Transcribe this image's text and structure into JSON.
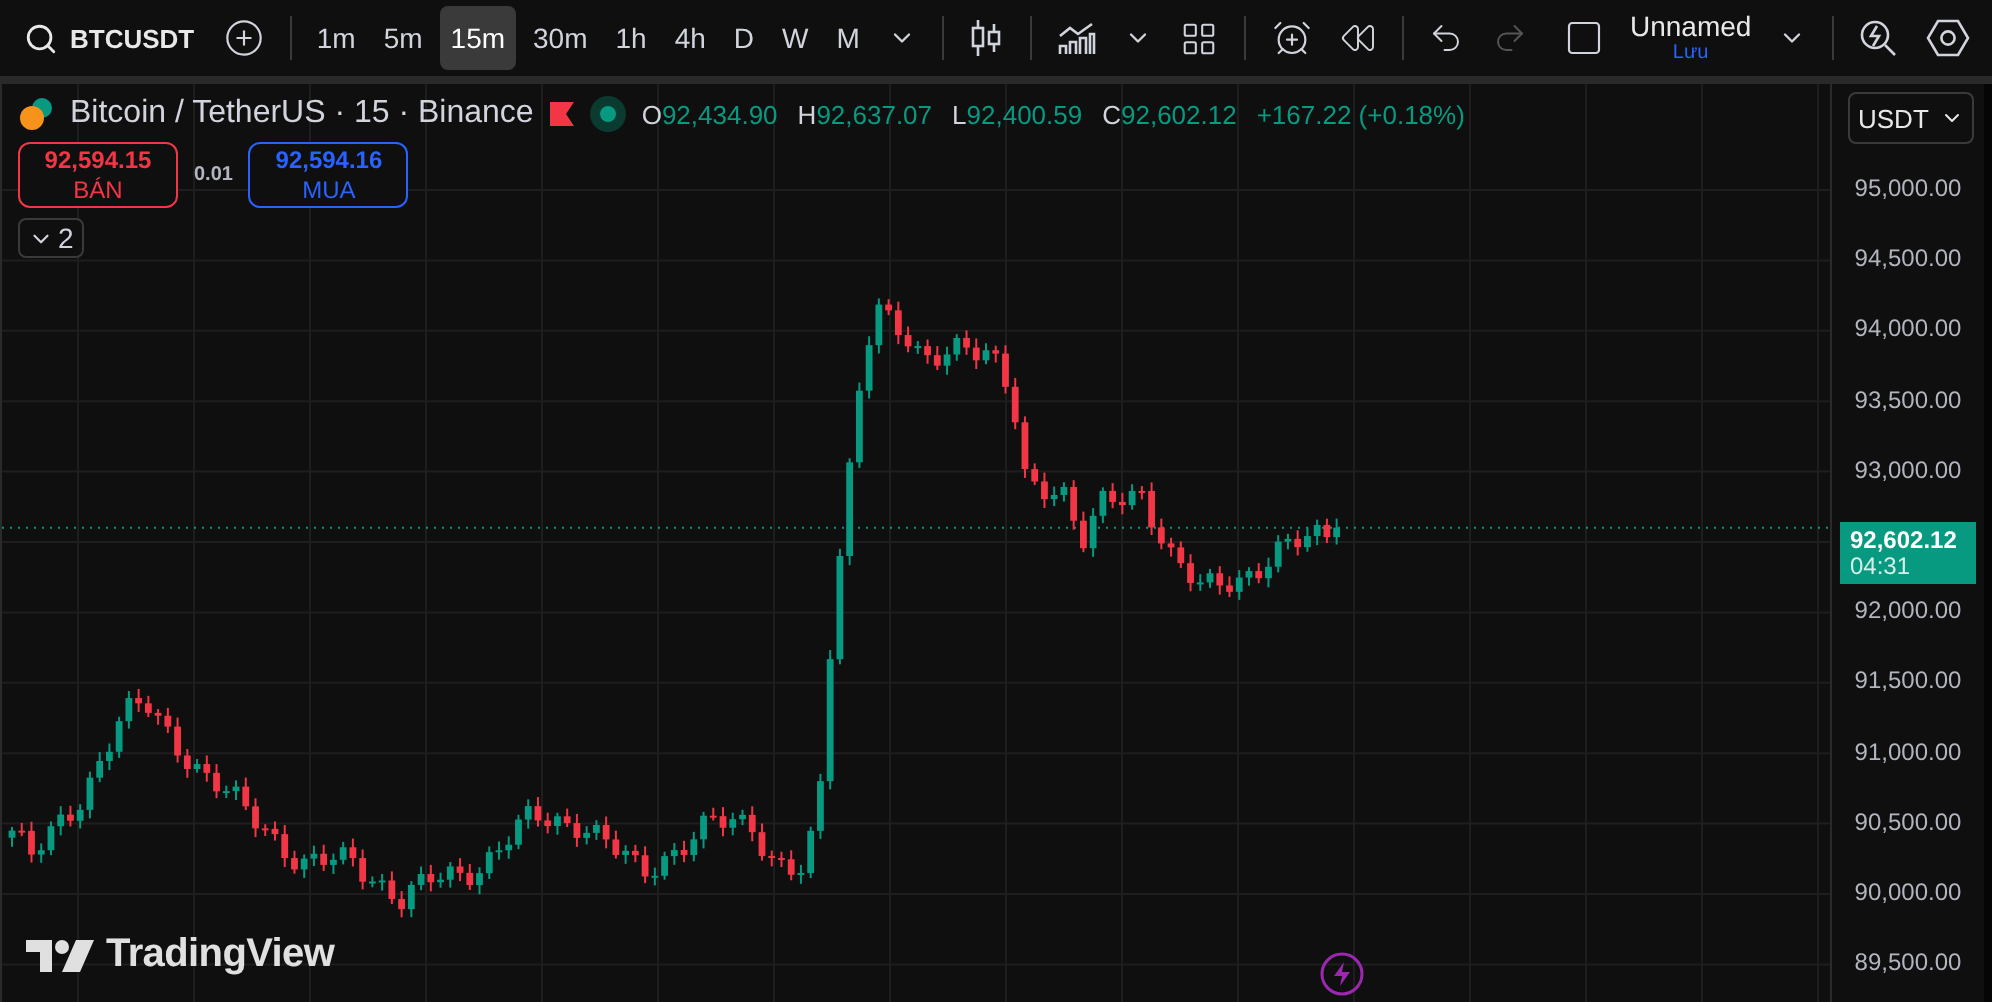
{
  "toolbar": {
    "symbol": "BTCUSDT",
    "intervals": [
      {
        "label": "1m",
        "selected": false
      },
      {
        "label": "5m",
        "selected": false
      },
      {
        "label": "15m",
        "selected": true
      },
      {
        "label": "30m",
        "selected": false
      },
      {
        "label": "1h",
        "selected": false
      },
      {
        "label": "4h",
        "selected": false
      },
      {
        "label": "D",
        "selected": false
      },
      {
        "label": "W",
        "selected": false
      },
      {
        "label": "M",
        "selected": false
      }
    ],
    "history": [
      {
        "kind": "undo",
        "disabled": false
      },
      {
        "kind": "redo",
        "disabled": true
      }
    ],
    "layout": {
      "name": "Unnamed",
      "action": "Lưu"
    }
  },
  "legend": {
    "title": "Bitcoin / TetherUS · 15 · Binance",
    "ohlc": [
      {
        "label": "O",
        "value": "92,434.90"
      },
      {
        "label": "H",
        "value": "92,637.07"
      },
      {
        "label": "L",
        "value": "92,400.59"
      },
      {
        "label": "C",
        "value": "92,602.12"
      }
    ],
    "change": "+167.22 (+0.18%)"
  },
  "trade": {
    "sell": {
      "price": "92,594.15",
      "label": "BÁN"
    },
    "quantity": "0.01",
    "buy": {
      "price": "92,594.16",
      "label": "MUA"
    }
  },
  "indicators_toggle": {
    "count": "2"
  },
  "price_axis": {
    "currency": "USDT",
    "upper_labels": [
      "95,000.00",
      "94,500.00",
      "94,000.00",
      "93,500.00",
      "93,000.00"
    ],
    "lower_labels": [
      "92,000.00",
      "91,500.00",
      "91,000.00",
      "90,500.00",
      "90,000.00",
      "89,500.00"
    ],
    "last_price": "92,602.12",
    "countdown": "04:31"
  },
  "brand": "TradingView"
}
